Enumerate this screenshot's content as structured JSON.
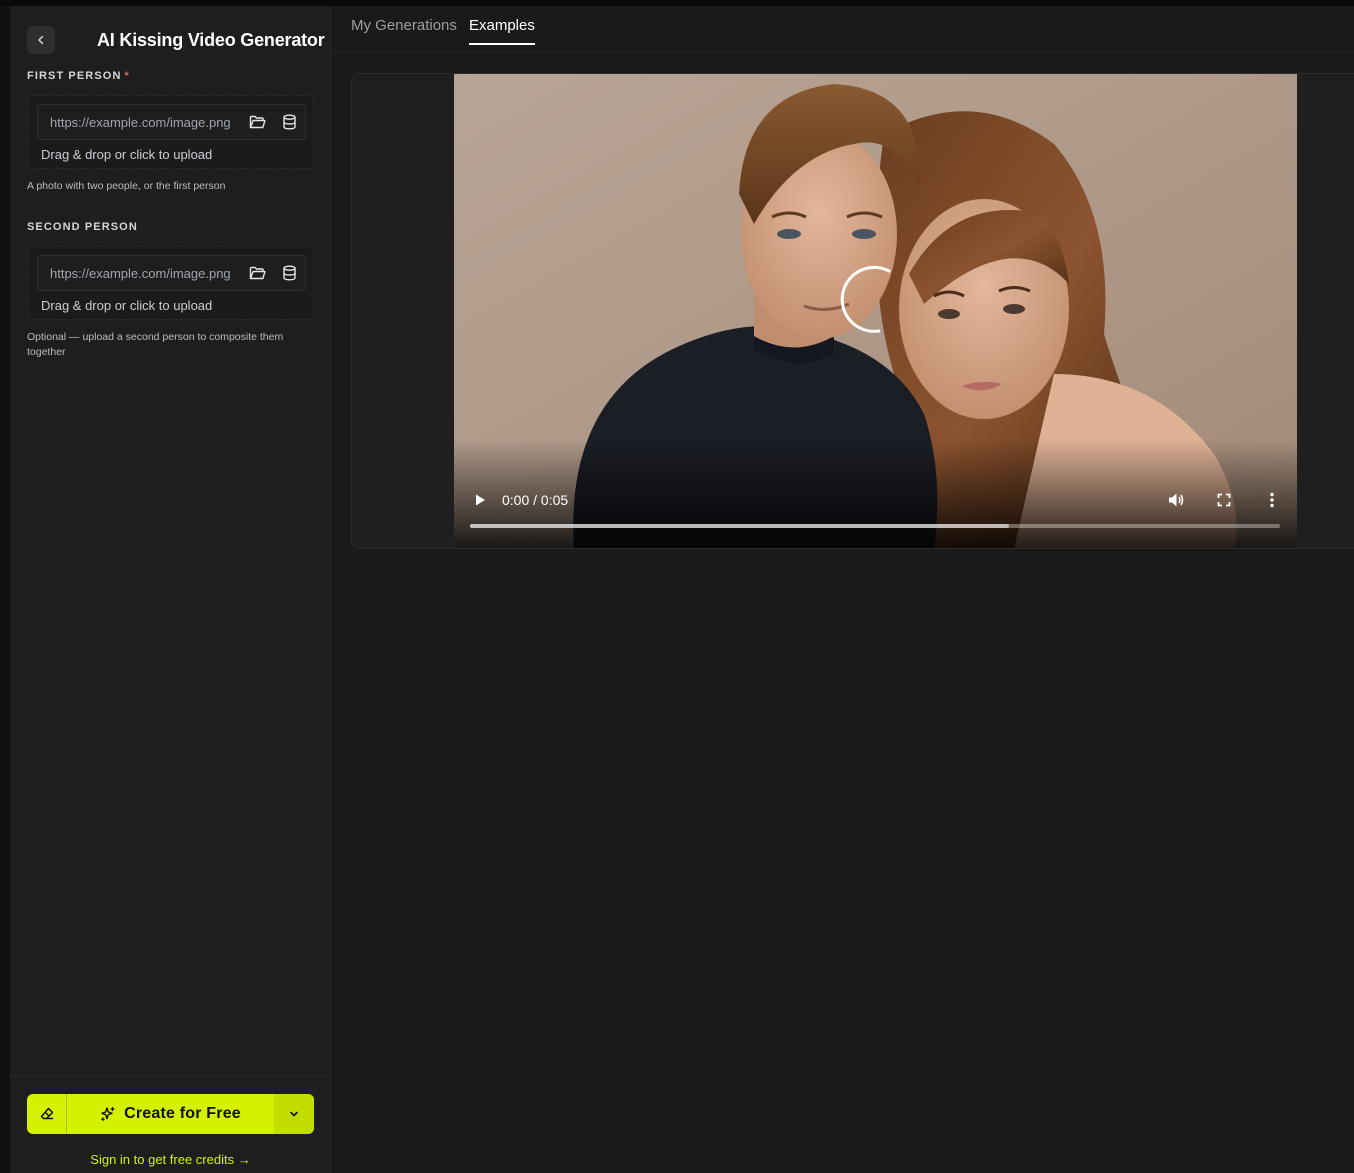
{
  "sidebar": {
    "title": "AI Kissing Video Generator",
    "first_person": {
      "label": "FIRST PERSON",
      "required_marker": "*",
      "placeholder": "https://example.com/image.png",
      "drop_text": "Drag & drop or click to upload",
      "hint": "A photo with two people, or the first person"
    },
    "second_person": {
      "label": "SECOND PERSON",
      "placeholder": "https://example.com/image.png",
      "drop_text": "Drag & drop or click to upload",
      "hint": "Optional — upload a second person to composite them together"
    },
    "create_label": "Create for Free",
    "signin_text": "Sign in to get free credits →"
  },
  "tabs": [
    {
      "label": "My Generations",
      "active": false
    },
    {
      "label": "Examples",
      "active": true
    }
  ],
  "player": {
    "current_time": "0:00",
    "duration": "0:05",
    "time_display": "0:00 / 0:05",
    "buffered": 0.665
  },
  "colors": {
    "accent": "#d4f200",
    "background": "#1a1a1a",
    "sidebar": "#1e1e1e",
    "required": "#e06a5c"
  },
  "icons": {
    "back": "chevron-left-icon",
    "folder": "folder-open-icon",
    "database": "database-icon",
    "eraser": "eraser-icon",
    "sparkle": "sparkle-icon",
    "dropdown": "chevron-down-icon",
    "play": "play-icon",
    "volume": "volume-icon",
    "fullscreen": "fullscreen-icon",
    "more": "more-vertical-icon"
  }
}
